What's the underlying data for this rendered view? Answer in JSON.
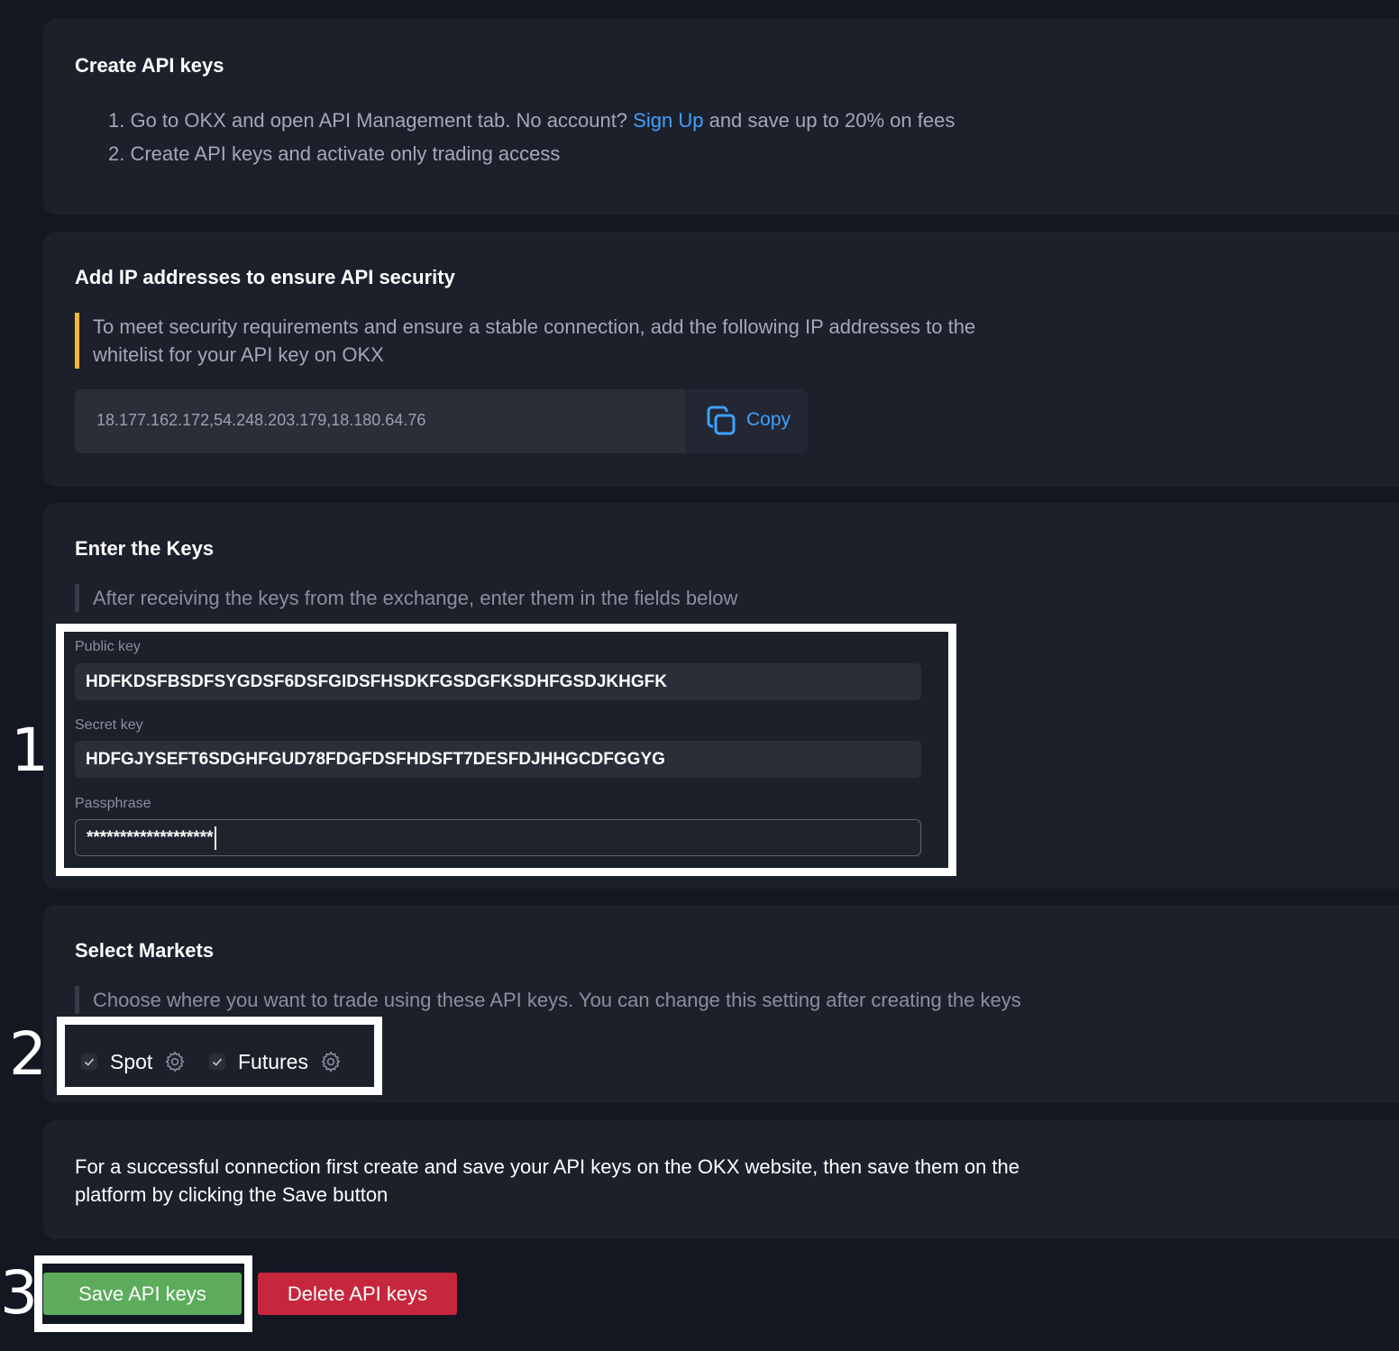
{
  "create_card": {
    "title": "Create API keys",
    "step1_prefix": "1. Go to OKX and open API Management tab. No account?",
    "step1_link": "Sign Up",
    "step1_suffix": "and save up to 20% on fees",
    "step2": "2. Create API keys and activate only trading access"
  },
  "ip_card": {
    "title": "Add IP addresses to ensure API security",
    "note_line1": "To meet security requirements and ensure a stable connection, add the following IP addresses to the",
    "note_line2": "whitelist for your API key on OKX",
    "ip_value": "18.177.162.172,54.248.203.179,18.180.64.76",
    "copy_label": "Copy"
  },
  "keys_card": {
    "title": "Enter the Keys",
    "note": "After receiving the keys from the exchange, enter them in the fields below",
    "public_key_label": "Public key",
    "public_key_value": "HDFKDSFBSDFSYGDSF6DSFGIDSFHSDKFGSDGFKSDHFGSDJKHGFK",
    "secret_key_label": "Secret key",
    "secret_key_value": "HDFGJYSEFT6SDGHFGUD78FDGFDSFHDSFT7DESFDJHHGCDFGGYG",
    "passphrase_label": "Passphrase",
    "passphrase_value": "*******************"
  },
  "markets_card": {
    "title": "Select Markets",
    "note": "Choose where you want to trade using these API keys. You can change this setting after creating the keys",
    "markets": [
      {
        "label": "Spot",
        "checked": true
      },
      {
        "label": "Futures",
        "checked": true
      }
    ]
  },
  "info_card": {
    "line1": "For a successful connection first create and save your API keys on the OKX website, then save them on the",
    "line2": "platform by clicking the Save button"
  },
  "buttons": {
    "save": "Save API keys",
    "delete": "Delete API keys"
  },
  "annotations": [
    "1",
    "2",
    "3"
  ],
  "colors": {
    "background": "#131722",
    "card": "#1c202b",
    "link": "#3ea2ff",
    "warning_bar": "#f3ba2f",
    "save_button": "#5cac5c",
    "delete_button": "#c6273c"
  }
}
